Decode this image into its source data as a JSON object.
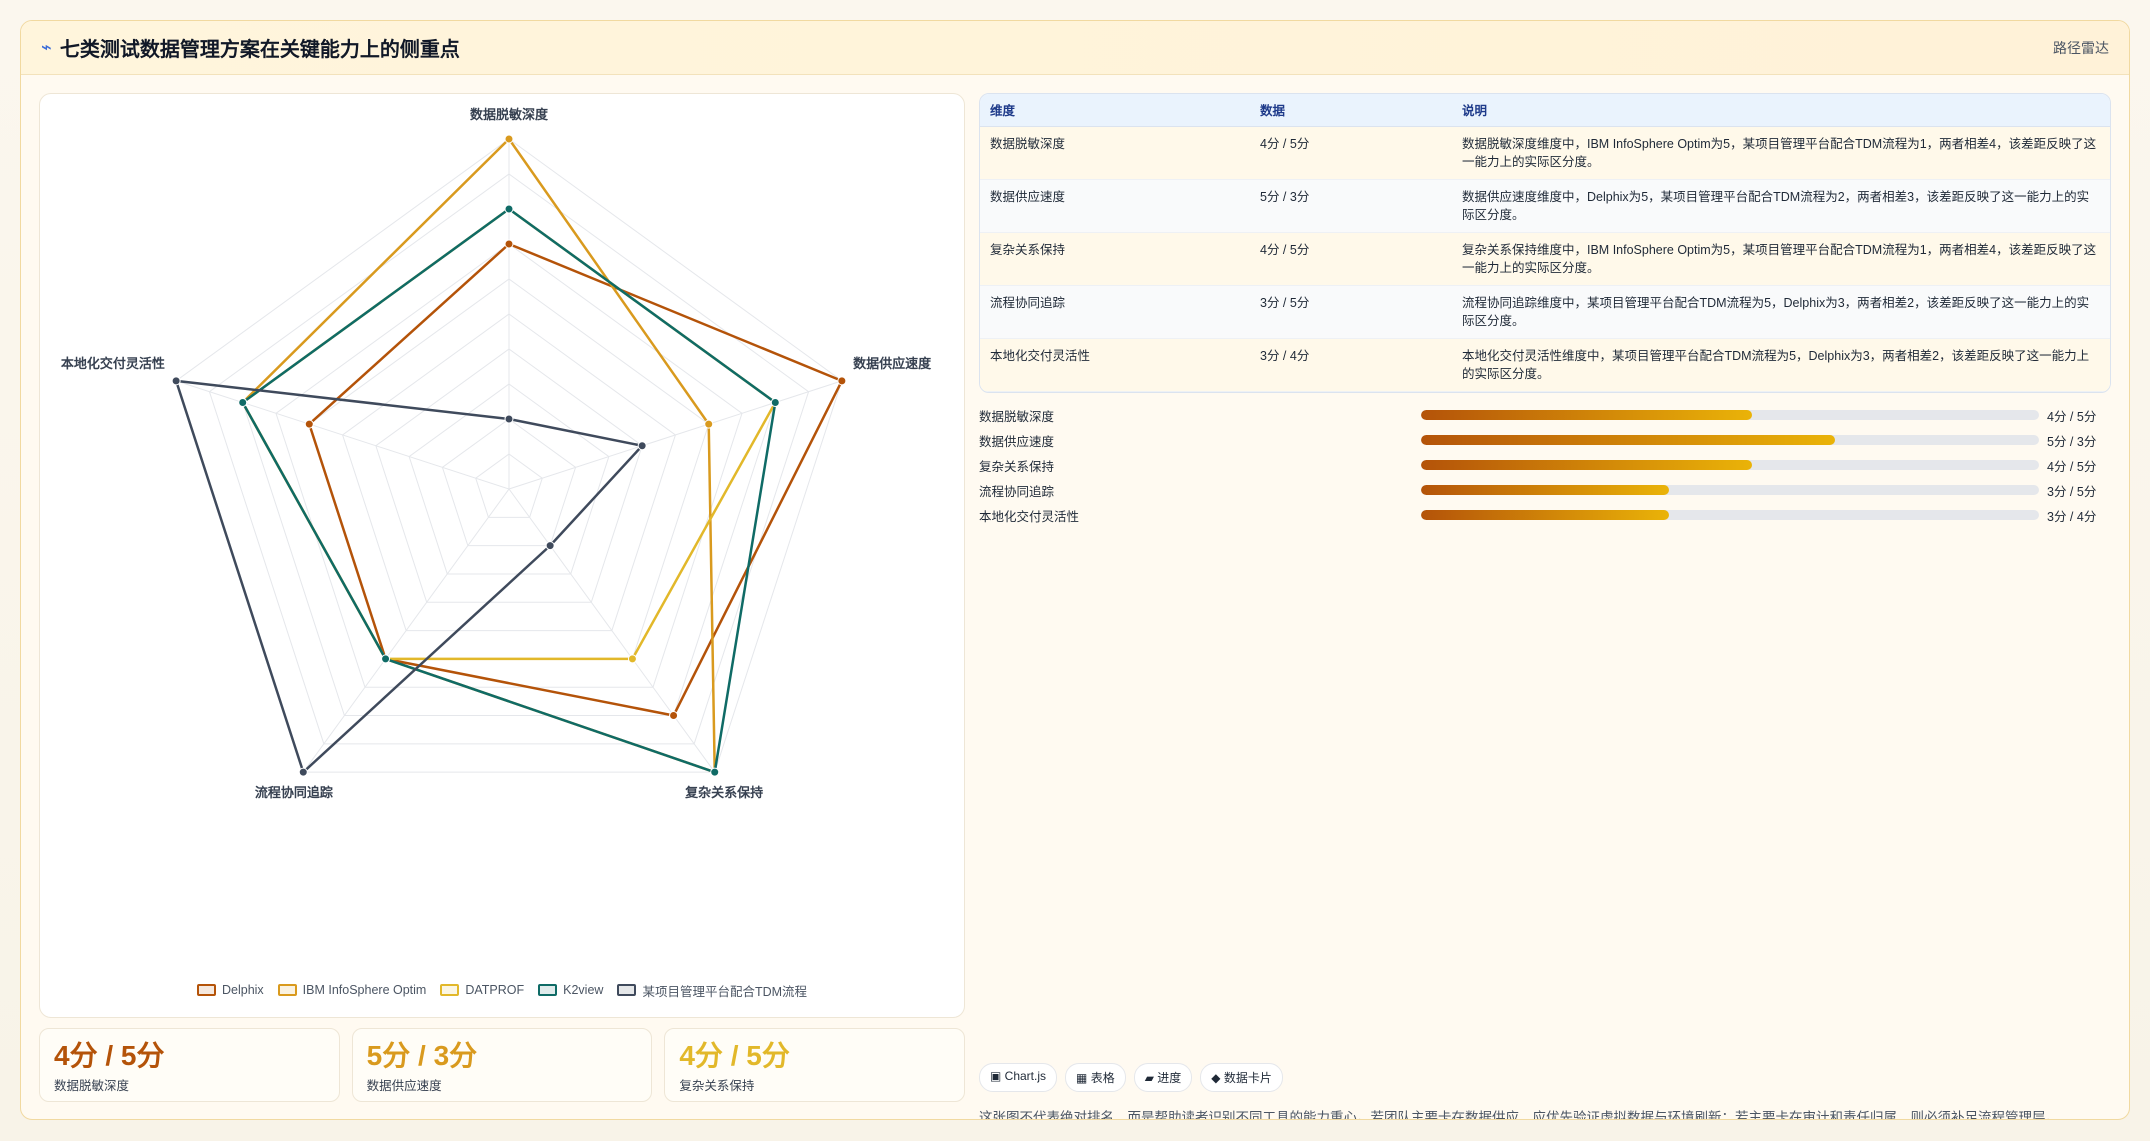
{
  "header": {
    "icon": "lightning-icon",
    "title": "七类测试数据管理方案在关键能力上的侧重点",
    "tag": "路径雷达"
  },
  "chart_data": {
    "type": "radar",
    "axes": [
      "数据脱敏深度",
      "数据供应速度",
      "复杂关系保持",
      "流程协同追踪",
      "本地化交付灵活性"
    ],
    "range": [
      0,
      5
    ],
    "series": [
      {
        "name": "Delphix",
        "color": "#b45309",
        "values": [
          3.5,
          5,
          4,
          3,
          3
        ]
      },
      {
        "name": "IBM InfoSphere Optim",
        "color": "#d99a1e",
        "values": [
          5,
          3,
          5,
          3,
          4
        ]
      },
      {
        "name": "DATPROF",
        "color": "#e2b82a",
        "values": [
          4,
          4,
          3,
          3,
          4
        ]
      },
      {
        "name": "K2view",
        "color": "#0f6b66",
        "values": [
          4,
          4,
          5,
          3,
          4
        ]
      },
      {
        "name": "某项目管理平台配合TDM流程",
        "color": "#3f4a5c",
        "values": [
          1,
          2,
          1,
          5,
          5
        ]
      }
    ]
  },
  "cards": [
    {
      "value": "4分 / 5分",
      "label": "数据脱敏深度",
      "color": "#b45309"
    },
    {
      "value": "5分 / 3分",
      "label": "数据供应速度",
      "color": "#d99a1e"
    },
    {
      "value": "4分 / 5分",
      "label": "复杂关系保持",
      "color": "#e2b82a"
    }
  ],
  "table": {
    "headers": [
      "维度",
      "数据",
      "说明"
    ],
    "rows": [
      {
        "dim": "数据脱敏深度",
        "data": "4分 / 5分",
        "desc": "数据脱敏深度维度中，IBM InfoSphere Optim为5，某项目管理平台配合TDM流程为1，两者相差4，该差距反映了这一能力上的实际区分度。"
      },
      {
        "dim": "数据供应速度",
        "data": "5分 / 3分",
        "desc": "数据供应速度维度中，Delphix为5，某项目管理平台配合TDM流程为2，两者相差3，该差距反映了这一能力上的实际区分度。"
      },
      {
        "dim": "复杂关系保持",
        "data": "4分 / 5分",
        "desc": "复杂关系保持维度中，IBM InfoSphere Optim为5，某项目管理平台配合TDM流程为1，两者相差4，该差距反映了这一能力上的实际区分度。"
      },
      {
        "dim": "流程协同追踪",
        "data": "3分 / 5分",
        "desc": "流程协同追踪维度中，某项目管理平台配合TDM流程为5，Delphix为3，两者相差2，该差距反映了这一能力上的实际区分度。"
      },
      {
        "dim": "本地化交付灵活性",
        "data": "3分 / 4分",
        "desc": "本地化交付灵活性维度中，某项目管理平台配合TDM流程为5，Delphix为3，两者相差2，该差距反映了这一能力上的实际区分度。"
      }
    ]
  },
  "progress": [
    {
      "name": "数据脱敏深度",
      "value": "4分 / 5分",
      "fraction": 0.536
    },
    {
      "name": "数据供应速度",
      "value": "5分 / 3分",
      "fraction": 0.67
    },
    {
      "name": "复杂关系保持",
      "value": "4分 / 5分",
      "fraction": 0.536
    },
    {
      "name": "流程协同追踪",
      "value": "3分 / 5分",
      "fraction": 0.402
    },
    {
      "name": "本地化交付灵活性",
      "value": "3分 / 4分",
      "fraction": 0.402
    }
  ],
  "chips": [
    {
      "icon": "chart-icon",
      "glyph": "▣",
      "label": "Chart.js"
    },
    {
      "icon": "table-icon",
      "glyph": "▦",
      "label": "表格"
    },
    {
      "icon": "progress-icon",
      "glyph": "▰",
      "label": "进度"
    },
    {
      "icon": "card-icon",
      "glyph": "◆",
      "label": "数据卡片"
    }
  ],
  "note": "这张图不代表绝对排名，而是帮助读者识别不同工具的能力重心。若团队主要卡在数据供应，应优先验证虚拟数据与环境刷新；若主要卡在审计和责任归属，则必须补足流程管理层。"
}
